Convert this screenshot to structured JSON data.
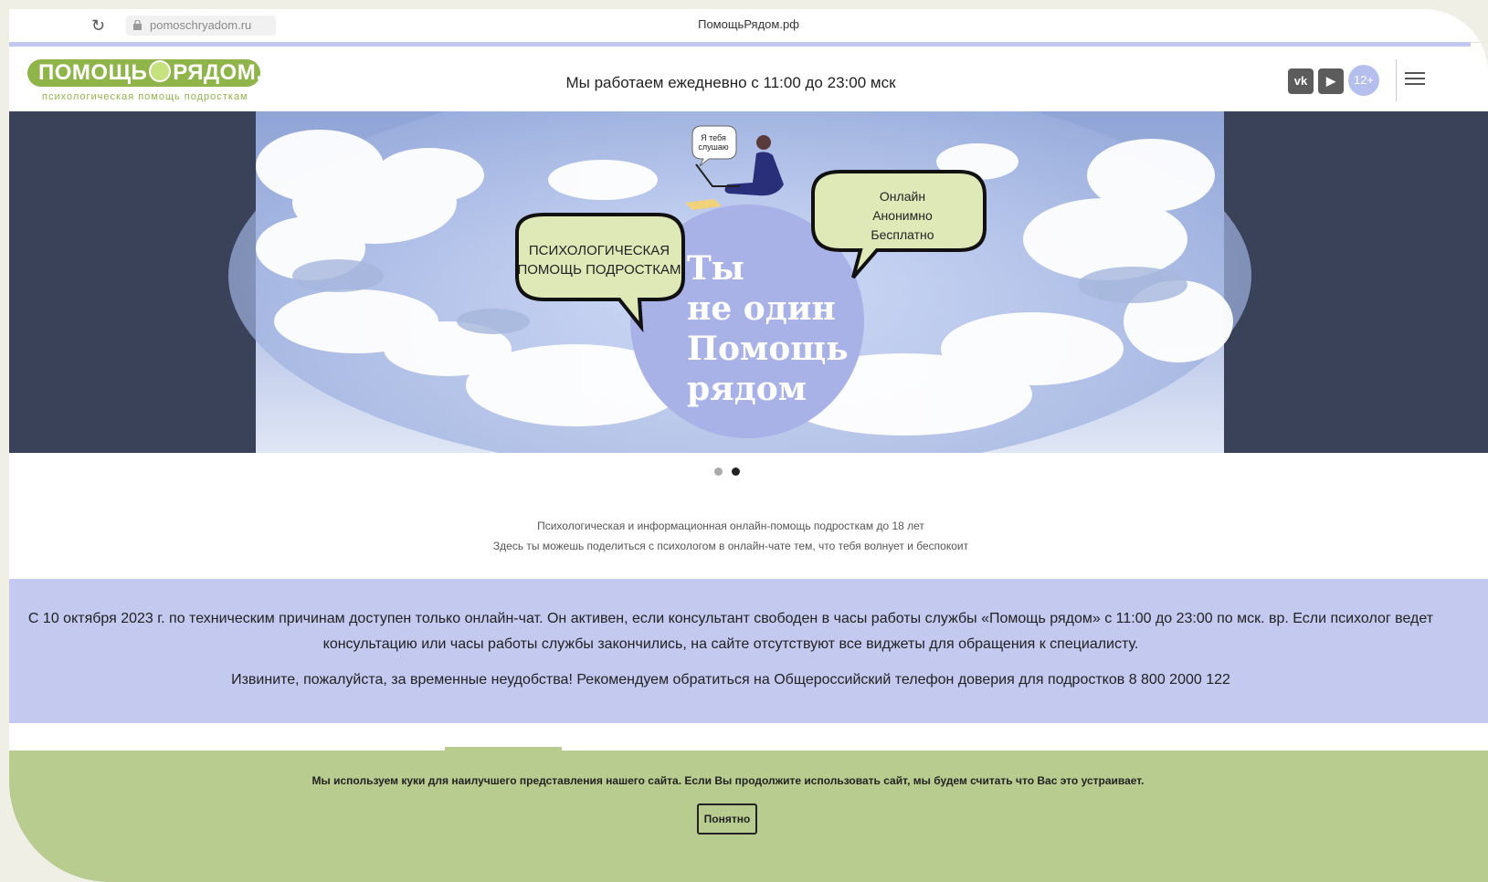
{
  "browser": {
    "url": "pomoschryadom.ru",
    "tab_title": "ПомощьРядом.рф"
  },
  "header": {
    "logo_text_left": "ПОМОЩЬ",
    "logo_text_right": "РЯДОМ.рф",
    "logo_subtitle": "психологическая помощь подросткам",
    "work_hours": "Мы работаем ежедневно с 11:00 до 23:00 мск",
    "vk_icon": "vk-icon",
    "youtube_icon": "youtube-icon",
    "age_badge": "12+"
  },
  "hero": {
    "bubble_small": "Я тебя слушаю",
    "bubble_left": "ПСИХОЛОГИЧЕСКАЯ ПОМОЩЬ ПОДРОСТКАМ",
    "bubble_right_lines": [
      "Онлайн",
      "Анонимно",
      "Бесплатно"
    ],
    "headline_lines": [
      "Ты",
      "не один",
      "Помощь",
      "рядом"
    ]
  },
  "slider": {
    "active_index": 2,
    "total": 2
  },
  "intro": {
    "line1": "Психологическая и информационная онлайн-помощь подросткам до 18 лет",
    "line2": "Здесь ты можешь поделиться с психологом в онлайн-чате тем, что тебя волнует и беспокоит"
  },
  "notice": {
    "paragraph1": "С 10 октября 2023 г. по техническим причинам доступен только онлайн-чат. Он активен, если консультант свободен в часы работы службы «Помощь рядом» с 11:00 до 23:00 по мск. вр. Если психолог ведет консультацию или часы работы службы закончились, на сайте отсутствуют все виджеты для обращения к специалисту.",
    "paragraph2": "Извините, пожалуйста, за временные неудобства! Рекомендуем обратиться на Общероссийский телефон доверия для подростков 8 800 2000 122"
  },
  "cookie": {
    "text": "Мы используем куки для наилучшего представления нашего сайта. Если Вы продолжите использовать сайт, мы будем считать что Вас это устраивает.",
    "button_label": "Понятно"
  },
  "colors": {
    "brand_green": "#8fb44a",
    "notice_lilac": "#c3c9ef",
    "cookie_green": "#b9cc8f",
    "hero_dark": "#3a4259"
  }
}
